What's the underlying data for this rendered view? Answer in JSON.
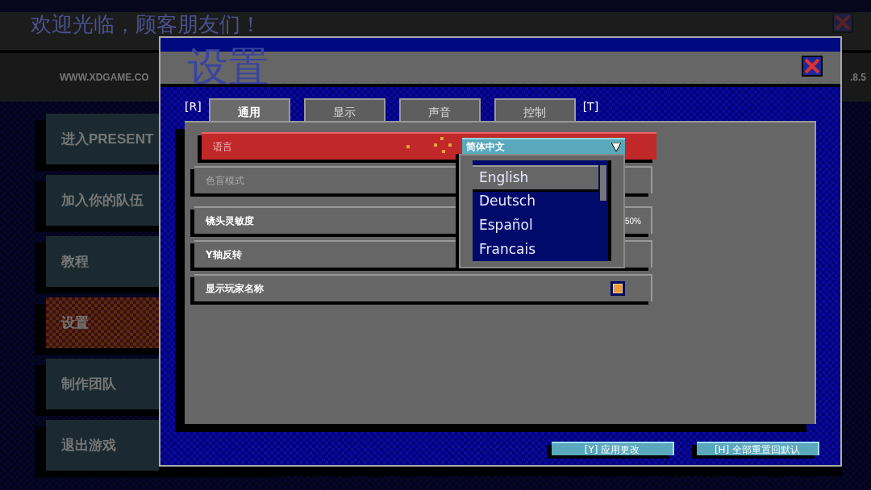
{
  "background": {
    "title": "欢迎光临，顾客朋友们！",
    "website": "WWW.XDGAME.CO",
    "version": ".8.5",
    "menu": [
      {
        "label": "进入PRESENT",
        "selected": false
      },
      {
        "label": "加入你的队伍",
        "selected": false
      },
      {
        "label": "教程",
        "selected": false
      },
      {
        "label": "设置",
        "selected": true
      },
      {
        "label": "制作团队",
        "selected": false
      },
      {
        "label": "退出游戏",
        "selected": false
      }
    ]
  },
  "dialog": {
    "title": "设置",
    "tab_prev_key": "[R]",
    "tab_next_key": "[T]",
    "tabs": [
      {
        "label": "通用",
        "selected": true
      },
      {
        "label": "显示",
        "selected": false
      },
      {
        "label": "声音",
        "selected": false
      },
      {
        "label": "控制",
        "selected": false
      }
    ],
    "settings": [
      {
        "kind": "dropdown",
        "label": "语言",
        "selected": true,
        "disabled": false,
        "value": "简体中文",
        "options": [
          {
            "label": "English",
            "selected": true
          },
          {
            "label": "Deutsch",
            "selected": false
          },
          {
            "label": "Español",
            "selected": false
          },
          {
            "label": "Francais",
            "selected": false
          }
        ]
      },
      {
        "kind": "toggle",
        "label": "色盲模式",
        "selected": false,
        "disabled": true
      },
      {
        "kind": "slider",
        "label": "镜头灵敏度",
        "selected": false,
        "disabled": false,
        "reading": "50%"
      },
      {
        "kind": "toggle",
        "label": "Y轴反转",
        "selected": false,
        "disabled": false
      },
      {
        "kind": "checkbox",
        "label": "显示玩家名称",
        "selected": false,
        "disabled": false,
        "checked": true
      }
    ],
    "buttons": [
      "[Y] 应用更改",
      "[H] 全部重置回默认"
    ]
  }
}
